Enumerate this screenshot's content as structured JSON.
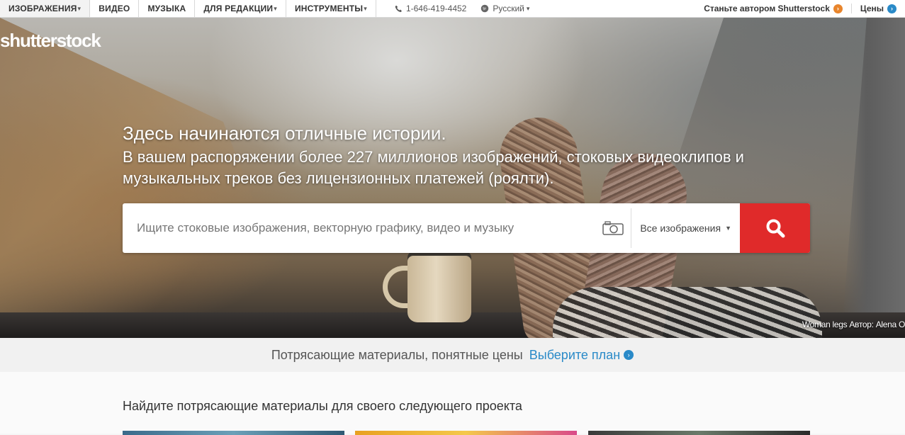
{
  "nav": {
    "items": [
      {
        "label": "ИЗОБРАЖЕНИЯ",
        "caret": "▾"
      },
      {
        "label": "ВИДЕО",
        "caret": ""
      },
      {
        "label": "МУЗЫКА",
        "caret": ""
      },
      {
        "label": "ДЛЯ РЕДАКЦИИ",
        "caret": "▾"
      },
      {
        "label": "ИНСТРУМЕНТЫ",
        "caret": "▾"
      }
    ],
    "phone": "1-646-419-4452",
    "language": "Русский",
    "language_caret": "▾",
    "become_contributor": "Станьте автором Shutterstock",
    "pricing": "Цены"
  },
  "hero": {
    "logo": "shutterstock",
    "headline": "Здесь начинаются отличные истории.",
    "subline": "В вашем распоряжении более 227 миллионов изображений, стоковых видеоклипов и музыкальных треков без лицензионных платежей (роялти).",
    "search_placeholder": "Ищите стоковые изображения, векторную графику, видео и музыку",
    "search_scope": "Все изображения",
    "photo_credit": "Woman legs Автор: Alena O"
  },
  "promo": {
    "text": "Потрясающие материалы, понятные цены",
    "link": "Выберите план"
  },
  "section": {
    "title": "Найдите потрясающие материалы для своего следующего проекта"
  },
  "colors": {
    "accent_red": "#e02a2a",
    "link_blue": "#2a8ac8",
    "contributor_orange": "#e8852c"
  }
}
